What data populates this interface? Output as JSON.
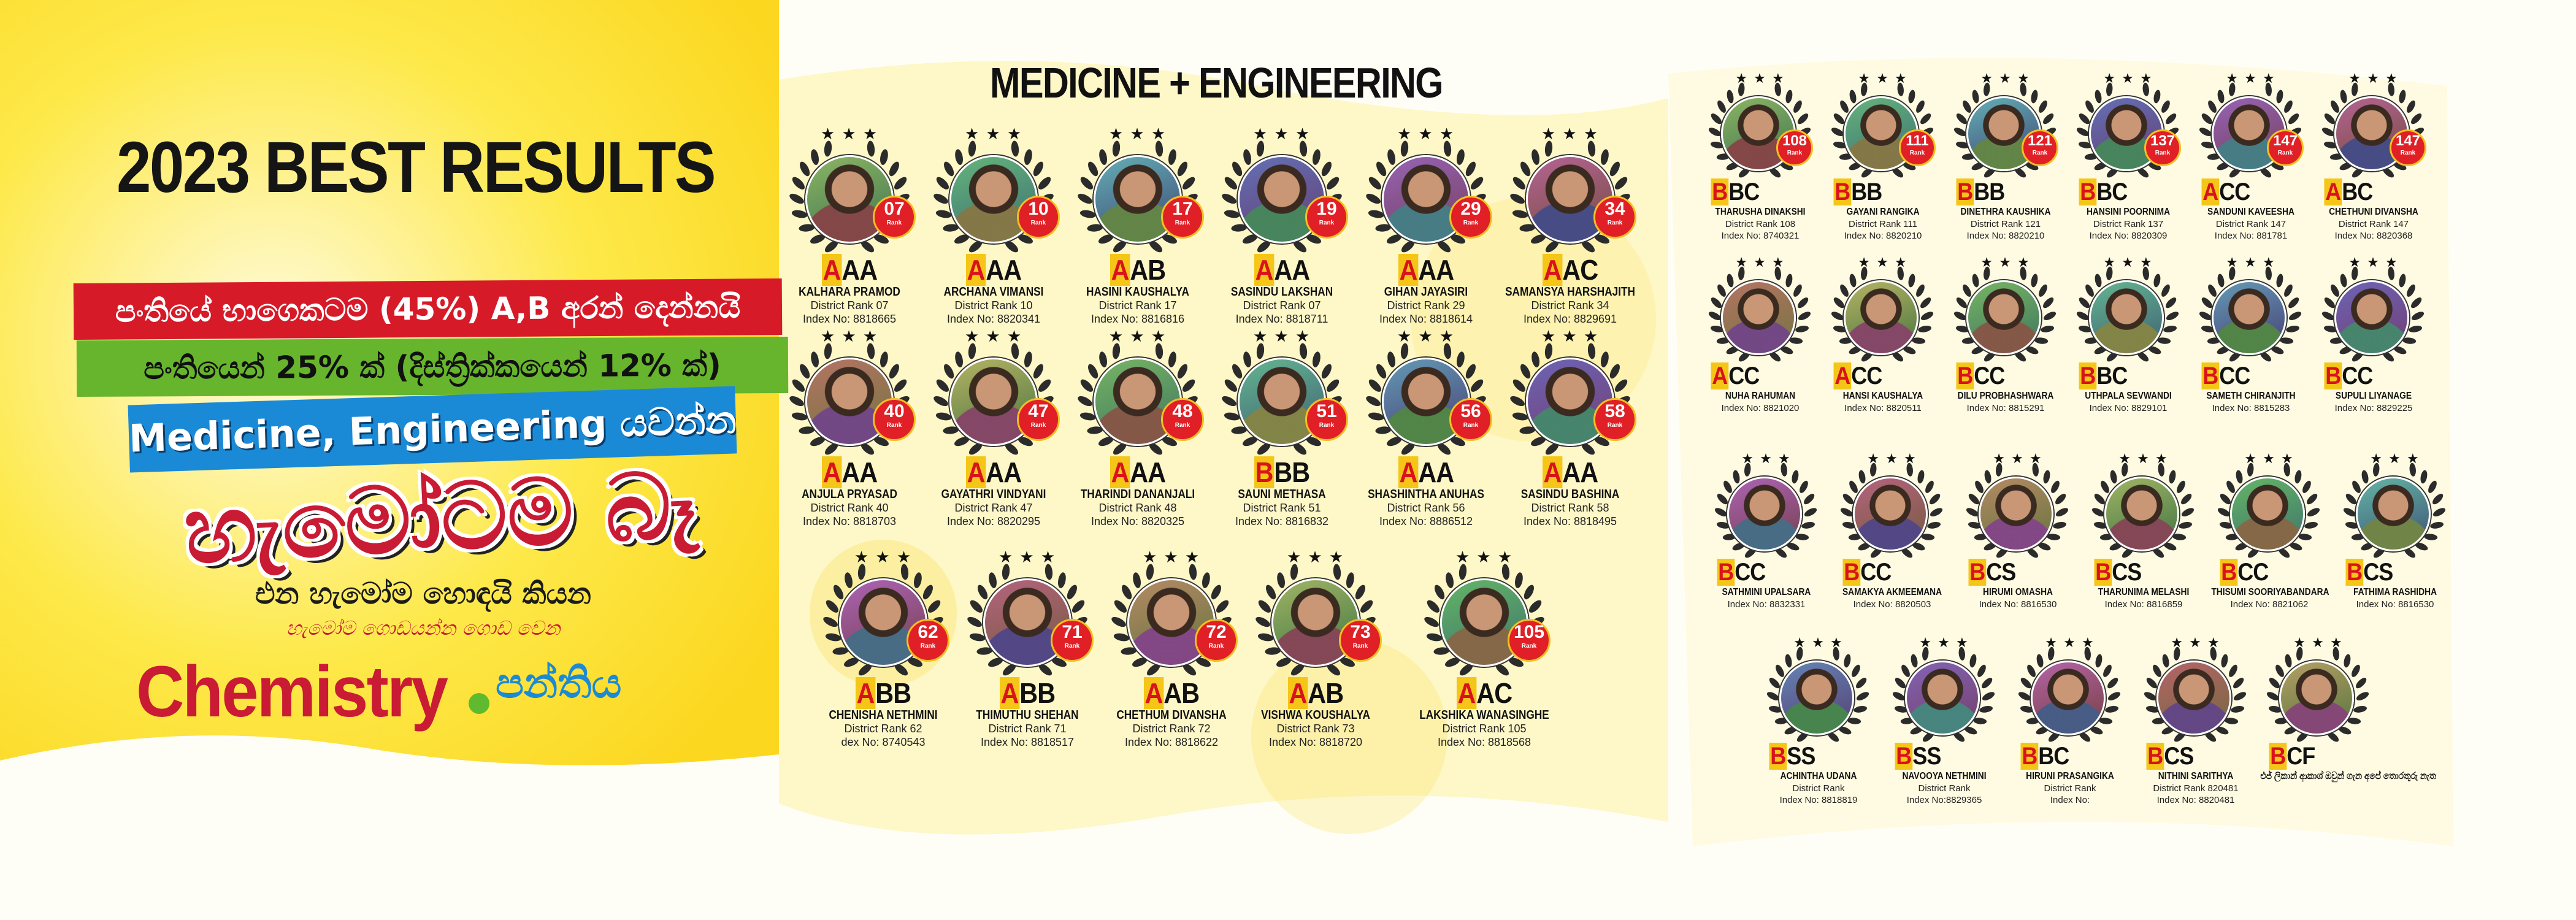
{
  "headline": "2023 BEST RESULTS",
  "strip_1": "පංතියේ භාගෙකටම (45%) A,B අරන් දෙන්නයි",
  "strip_2": "පංතියෙන් 25% ක් (දිස්ත්‍රික්කයෙන් 12% ක්)",
  "strip_3": "Medicine, Engineering යවන්නයි.",
  "brand_big": "හැමෝටම බෑ",
  "brand_sub": "එන හැමෝම හොඳයි කියන",
  "brand_tagline": "හැමෝම ගොඩයන්න ගොඩ වෙන",
  "chem_en": "Chemistry",
  "chem_si": "පන්තිය",
  "section_title": "MEDICINE + ENGINEERING",
  "rank_word": "Rank",
  "left_students": [
    {
      "rank": "07",
      "grade_first": "A",
      "grade_rest": "AA",
      "name": "KALHARA PRAMOD",
      "district": "District Rank 07",
      "index": "Index No: 8818665"
    },
    {
      "rank": "10",
      "grade_first": "A",
      "grade_rest": "AA",
      "name": "ARCHANA VIMANSI",
      "district": "District Rank 10",
      "index": "Index No: 8820341"
    },
    {
      "rank": "17",
      "grade_first": "A",
      "grade_rest": "AB",
      "name": "HASINI KAUSHALYA",
      "district": "District Rank 17",
      "index": "Index No: 8816816"
    },
    {
      "rank": "19",
      "grade_first": "A",
      "grade_rest": "AA",
      "name": "SASINDU LAKSHAN",
      "district": "District Rank 07",
      "index": "Index No: 8818711"
    },
    {
      "rank": "29",
      "grade_first": "A",
      "grade_rest": "AA",
      "name": "GIHAN JAYASIRI",
      "district": "District Rank 29",
      "index": "Index No: 8818614"
    },
    {
      "rank": "34",
      "grade_first": "A",
      "grade_rest": "AC",
      "name": "SAMANSYA HARSHAJITH",
      "district": "District Rank 34",
      "index": "Index No: 8829691"
    },
    {
      "rank": "40",
      "grade_first": "A",
      "grade_rest": "AA",
      "name": "ANJULA PRYASAD",
      "district": "District Rank 40",
      "index": "Index No: 8818703"
    },
    {
      "rank": "47",
      "grade_first": "A",
      "grade_rest": "AA",
      "name": "GAYATHRI VINDYANI",
      "district": "District Rank 47",
      "index": "Index No: 8820295"
    },
    {
      "rank": "48",
      "grade_first": "A",
      "grade_rest": "AA",
      "name": "THARINDI DANANJALI",
      "district": "District Rank 48",
      "index": "Index No: 8820325"
    },
    {
      "rank": "51",
      "grade_first": "B",
      "grade_rest": "BB",
      "name": "SAUNI METHASA",
      "district": "District Rank 51",
      "index": "Index No: 8816832"
    },
    {
      "rank": "56",
      "grade_first": "A",
      "grade_rest": "AA",
      "name": "SHASHINTHA ANUHAS",
      "district": "District Rank 56",
      "index": "Index No: 8886512"
    },
    {
      "rank": "58",
      "grade_first": "A",
      "grade_rest": "AA",
      "name": "SASINDU BASHINA",
      "district": "District Rank 58",
      "index": "Index No: 8818495"
    },
    {
      "rank": "62",
      "grade_first": "A",
      "grade_rest": "BB",
      "name": "CHENISHA NETHMINI",
      "district": "District Rank 62",
      "index": "dex No: 8740543"
    },
    {
      "rank": "71",
      "grade_first": "A",
      "grade_rest": "BB",
      "name": "THIMUTHU SHEHAN",
      "district": "District Rank 71",
      "index": "Index No: 8818517"
    },
    {
      "rank": "72",
      "grade_first": "A",
      "grade_rest": "AB",
      "name": "CHETHUM DIVANSHA",
      "district": "District Rank 72",
      "index": "Index No: 8818622"
    },
    {
      "rank": "73",
      "grade_first": "A",
      "grade_rest": "AB",
      "name": "VISHWA KOUSHALYA",
      "district": "District Rank 73",
      "index": "Index No: 8818720"
    },
    {
      "rank": "105",
      "grade_first": "A",
      "grade_rest": "AC",
      "name": "LAKSHIKA WANASINGHE",
      "district": "District Rank 105",
      "index": "Index No: 8818568"
    }
  ],
  "right_students": [
    {
      "rank": "108",
      "grade_first": "B",
      "grade_rest": "BC",
      "name": "THARUSHA DINAKSHI",
      "district": "District Rank 108",
      "index": "Index No: 8740321"
    },
    {
      "rank": "111",
      "grade_first": "B",
      "grade_rest": "BB",
      "name": "GAYANI RANGIKA",
      "district": "District Rank 111",
      "index": "Index No: 8820210"
    },
    {
      "rank": "121",
      "grade_first": "B",
      "grade_rest": "BB",
      "name": "DINETHRA KAUSHIKA",
      "district": "District Rank 121",
      "index": "Index No: 8820210"
    },
    {
      "rank": "137",
      "grade_first": "B",
      "grade_rest": "BC",
      "name": "HANSINI POORNIMA",
      "district": "District Rank 137",
      "index": "Index No: 8820309"
    },
    {
      "rank": "147",
      "grade_first": "A",
      "grade_rest": "CC",
      "name": "SANDUNI KAVEESHA",
      "district": "District Rank 147",
      "index": "Index No: 881781"
    },
    {
      "rank": "147",
      "grade_first": "A",
      "grade_rest": "BC",
      "name": "CHETHUNI DIVANSHA",
      "district": "District Rank 147",
      "index": "Index No: 8820368"
    },
    {
      "rank": "",
      "grade_first": "A",
      "grade_rest": "CC",
      "name": "NUHA RAHUMAN",
      "district": "",
      "index": "Index No: 8821020"
    },
    {
      "rank": "",
      "grade_first": "A",
      "grade_rest": "CC",
      "name": "HANSI KAUSHALYA",
      "district": "",
      "index": "Index No: 8820511"
    },
    {
      "rank": "",
      "grade_first": "B",
      "grade_rest": "CC",
      "name": "DILU PROBHASHWARA",
      "district": "",
      "index": "Index No: 8815291"
    },
    {
      "rank": "",
      "grade_first": "B",
      "grade_rest": "BC",
      "name": "UTHPALA SEVWANDI",
      "district": "",
      "index": "Index No: 8829101"
    },
    {
      "rank": "",
      "grade_first": "B",
      "grade_rest": "CC",
      "name": "SAMETH CHIRANJITH",
      "district": "",
      "index": "Index No: 8815283"
    },
    {
      "rank": "",
      "grade_first": "B",
      "grade_rest": "CC",
      "name": "SUPULI LIYANAGE",
      "district": "",
      "index": "Index No: 8829225"
    },
    {
      "rank": "",
      "grade_first": "B",
      "grade_rest": "CC",
      "name": "SATHMINI UPALSARA",
      "district": "",
      "index": "Index No: 8832331"
    },
    {
      "rank": "",
      "grade_first": "B",
      "grade_rest": "CC",
      "name": "SAMAKYA AKMEEMANA",
      "district": "",
      "index": "Index No: 8820503"
    },
    {
      "rank": "",
      "grade_first": "B",
      "grade_rest": "CS",
      "name": "HIRUMI OMASHA",
      "district": "",
      "index": "Index No: 8816530"
    },
    {
      "rank": "",
      "grade_first": "B",
      "grade_rest": "CS",
      "name": "THARUNIMA MELASHI",
      "district": "",
      "index": "Index No: 8816859"
    },
    {
      "rank": "",
      "grade_first": "B",
      "grade_rest": "CC",
      "name": "THISUMI SOORIYABANDARA",
      "district": "",
      "index": "Index No: 8821062"
    },
    {
      "rank": "",
      "grade_first": "B",
      "grade_rest": "CS",
      "name": "FATHIMA RASHIDHA",
      "district": "",
      "index": "Index No: 8816530"
    },
    {
      "rank": "",
      "grade_first": "B",
      "grade_rest": "SS",
      "name": "ACHINTHA UDANA",
      "district": "District Rank",
      "index": "Index No: 8818819"
    },
    {
      "rank": "",
      "grade_first": "B",
      "grade_rest": "SS",
      "name": "NAVOOYA NETHMINI",
      "district": "District Rank",
      "index": "Index No:8829365"
    },
    {
      "rank": "",
      "grade_first": "B",
      "grade_rest": "BC",
      "name": "HIRUNI PRASANGIKA",
      "district": "District Rank",
      "index": "Index No:"
    },
    {
      "rank": "",
      "grade_first": "B",
      "grade_rest": "CS",
      "name": "NITHINI SARITHYA",
      "district": "District Rank 820481",
      "index": "Index No: 8820481"
    },
    {
      "rank": "",
      "grade_first": "B",
      "grade_rest": "CF",
      "name": "එජ් ලිකාන් ආකාශ් ඔවුන් ගැන අපේ තොරතුරු නැත",
      "district": "",
      "index": ""
    }
  ],
  "colors": {
    "accent_red": "#d71a28",
    "accent_green": "#67b52c",
    "accent_blue": "#1b8ad6",
    "grade_yellow": "#f5c518",
    "bg_yellow": "#fde84a"
  }
}
